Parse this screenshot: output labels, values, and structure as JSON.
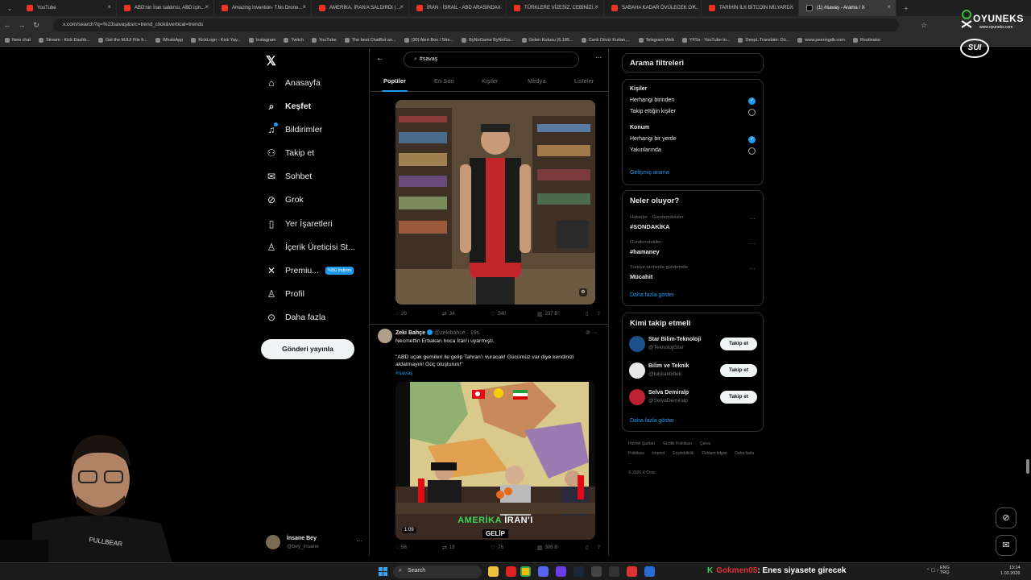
{
  "browser": {
    "tabs": [
      {
        "label": "YouTube",
        "fav": "yt"
      },
      {
        "label": "ABD'nin İran saldırısı, ABD için...",
        "fav": "yt"
      },
      {
        "label": "Amazing Invention- This Drone...",
        "fav": "yt"
      },
      {
        "label": "AMERİKA, İRAN'A SALDIRDI | ...",
        "fav": "yt"
      },
      {
        "label": "İRAN - İSRAİL - ABD ARASINDA...",
        "fav": "yt"
      },
      {
        "label": "TÜRKLERE VİZESİZ, CEBİNİZİ...",
        "fav": "yt"
      },
      {
        "label": "SABAHA KADAR ÖVÜLECEK OY...",
        "fav": "yt"
      },
      {
        "label": "TARİHİN İLK BİTCOİN MİLYARD...",
        "fav": "yt"
      },
      {
        "label": "(1) #savaş - Arama / X",
        "fav": "x",
        "active": true
      }
    ],
    "url": "x.com/search?q=%23savaş&src=trend_click&vertical=trends",
    "bookmarks": [
      "New chat",
      "Stream - Kick Dashb...",
      "Get the MJUI File fr...",
      "WhatsApp",
      "KickLogo - Kick Yay...",
      "Instagram",
      "Twitch",
      "YouTube",
      "The best ChatBot an...",
      "(30) Alert Box / Stre...",
      "ByNoGame ByNoGa...",
      "Gelen Kutusu (6.185...",
      "Canlı Döviz Kurları,...",
      "Telegram Web",
      "YFSs - YouTube to...",
      "DeepL Translate: Dü...",
      "www.peeringdb.com",
      "Routinator"
    ]
  },
  "brand": {
    "name": "OYUNEKS",
    "sub": "www.oyuneks.com",
    "sui": "SUI"
  },
  "leftnav": {
    "items": [
      {
        "label": "Anasayfa",
        "icon": "home-icon",
        "glyph": "⌂"
      },
      {
        "label": "Keşfet",
        "icon": "search-icon",
        "glyph": "⌕",
        "bold": true
      },
      {
        "label": "Bildirimler",
        "icon": "bell-icon",
        "glyph": "♫"
      },
      {
        "label": "Takip et",
        "icon": "person-add-icon",
        "glyph": "⚇"
      },
      {
        "label": "Sohbet",
        "icon": "mail-icon",
        "glyph": "✉"
      },
      {
        "label": "Grok",
        "icon": "grok-icon",
        "glyph": "⊘"
      },
      {
        "label": "Yer İşaretleri",
        "icon": "bookmark-icon",
        "glyph": "▯"
      },
      {
        "label": "İçerik Üreticisi St...",
        "icon": "creator-icon",
        "glyph": "♙"
      },
      {
        "label": "Premiu...",
        "icon": "x-premium-icon",
        "glyph": "✕"
      },
      {
        "label": "Profil",
        "icon": "profile-icon",
        "glyph": "♙"
      },
      {
        "label": "Daha fazla",
        "icon": "more-circle-icon",
        "glyph": "⊙"
      }
    ],
    "premium_badge": "%50 İndirim",
    "post_button": "Gönderi yayınla",
    "account": {
      "name": "İnsane Bey",
      "handle": "@bey_insane"
    }
  },
  "search": {
    "query": "#savaş",
    "tabs": [
      "Popüler",
      "En Son",
      "Kişiler",
      "Medya",
      "Listeler"
    ]
  },
  "post1": {
    "replies": "20",
    "reposts": "34",
    "likes": "540",
    "views": "237 B"
  },
  "post2": {
    "name": "Zeki Bahçe",
    "handle": "@zekibahce",
    "time": "· 19s",
    "line1": "Necmettin Erbakan hoca İran'ı uyarmıştı.",
    "line2": "\"ABD uçak gemileri ile gelip Tahran'ı vuracak! Gücümüz var diye kendinizi aldatmayın! Güç oluşturun!\"",
    "hashtag": "#savaş",
    "video_caption_green": "AMERİKA",
    "video_caption_white": "İRAN'I",
    "video_caption_2": "GELİP",
    "duration": "1:09",
    "replies": "58",
    "reposts": "18",
    "likes": "78",
    "views": "306 B"
  },
  "filters": {
    "title": "Arama filtreleri",
    "people_heading": "Kişiler",
    "people_opt1": "Herhangi birinden",
    "people_opt2": "Takip ettiğin kişiler",
    "location_heading": "Konum",
    "loc_opt1": "Herhangi bir yerde",
    "loc_opt2": "Yakınlarında",
    "advanced": "Gelişmiş arama"
  },
  "trends": {
    "title": "Neler oluyor?",
    "items": [
      {
        "category": "Haberler · Gündemdekiler",
        "tag": "#SONDAKİKA"
      },
      {
        "category": "Gündemdekiler",
        "tag": "#hamaney"
      },
      {
        "category": "Türkiye tarihinde gündemde",
        "tag": "Mücahit"
      }
    ],
    "more": "Daha fazla göster"
  },
  "whotofollow": {
    "title": "Kimi takip etmeli",
    "items": [
      {
        "name": "Star Bilim-Teknoloji",
        "handle": "@TeknolojiStar",
        "button": "Takip et",
        "color": "#1e4f8a"
      },
      {
        "name": "Bilim ve Teknik",
        "handle": "@tubitakbiltek",
        "button": "Takip et",
        "color": "#e8e8e8"
      },
      {
        "name": "Selva Demiralp",
        "handle": "@SelvaDemiralp",
        "button": "Takip et",
        "color": "#b23"
      }
    ],
    "more": "Daha fazla göster"
  },
  "footer": {
    "links": [
      "Hizmet Şartları",
      "Gizlilik Politikası",
      "Çerez Politikası",
      "Imprint",
      "Erişilebilirlik",
      "Reklam bilgisi",
      "Daha fazla ..."
    ],
    "copyright": "© 2026 X Corp."
  },
  "taskbar": {
    "search": "Search",
    "ticker_user": "Gokmen05",
    "ticker_text": ": Enes siyasete girecek",
    "lang1": "ENG",
    "lang2": "TRQ",
    "time": "13:14",
    "date": "1.03.2026"
  }
}
